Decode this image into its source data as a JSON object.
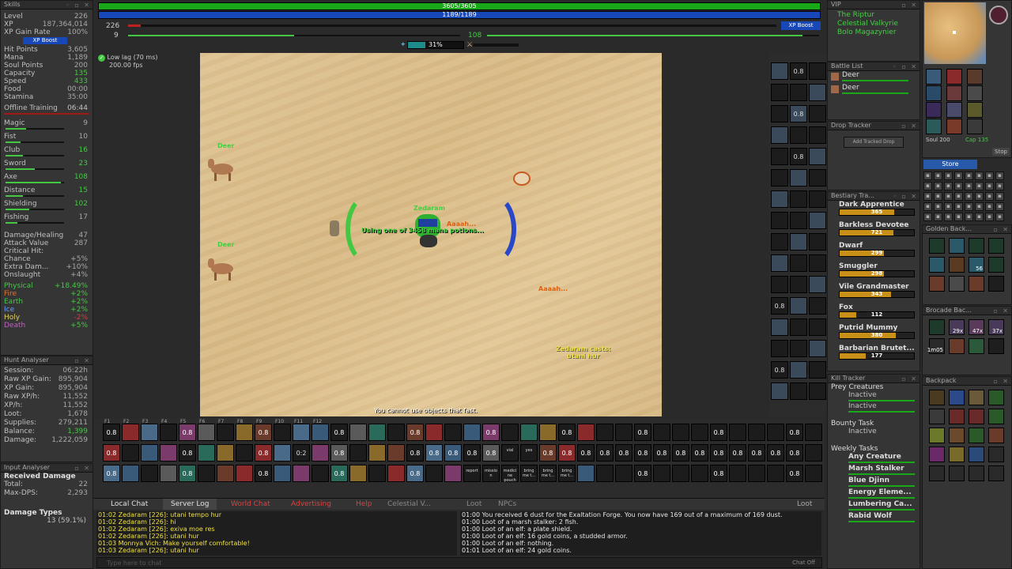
{
  "skills": {
    "title": "Skills",
    "stats": [
      {
        "label": "Level",
        "value": "226",
        "cls": "gray"
      },
      {
        "label": "XP",
        "value": "187,364,014",
        "cls": "gray"
      },
      {
        "label": "XP Gain Rate",
        "value": "100%",
        "cls": "gray"
      }
    ],
    "xp_boost": "XP Boost",
    "vitals": [
      {
        "label": "Hit Points",
        "value": "3,605",
        "cls": "gray"
      },
      {
        "label": "Mana",
        "value": "1,189",
        "cls": "gray"
      },
      {
        "label": "Soul Points",
        "value": "200",
        "cls": "gray"
      },
      {
        "label": "Capacity",
        "value": "135",
        "cls": "green"
      },
      {
        "label": "Speed",
        "value": "433",
        "cls": "green"
      },
      {
        "label": "Food",
        "value": "00:00",
        "cls": "gray"
      },
      {
        "label": "Stamina",
        "value": "35:00",
        "cls": "gray"
      }
    ],
    "offline_training": {
      "label": "Offline Training",
      "value": "06:44"
    },
    "skill_list": [
      {
        "label": "Magic",
        "value": "9",
        "cls": "gray",
        "progress": 0.35
      },
      {
        "label": "Fist",
        "value": "10",
        "cls": "gray",
        "progress": 0.25
      },
      {
        "label": "Club",
        "value": "16",
        "cls": "green",
        "progress": 0.3
      },
      {
        "label": "Sword",
        "value": "23",
        "cls": "green",
        "progress": 0.5
      },
      {
        "label": "Axe",
        "value": "108",
        "cls": "green",
        "progress": 0.95
      },
      {
        "label": "Distance",
        "value": "15",
        "cls": "green",
        "progress": 0.3
      },
      {
        "label": "Shielding",
        "value": "102",
        "cls": "green",
        "progress": 0.4
      },
      {
        "label": "Fishing",
        "value": "17",
        "cls": "gray",
        "progress": 0.2
      }
    ],
    "combat": [
      {
        "label": "Damage/Healing",
        "value": "47"
      },
      {
        "label": "Attack Value",
        "value": "287"
      },
      {
        "label": "Critical Hit:",
        "value": ""
      },
      {
        "label": "  Chance",
        "value": "+5%"
      },
      {
        "label": "  Extra Dam...",
        "value": "+10%"
      },
      {
        "label": "Onslaught",
        "value": "+4%"
      }
    ],
    "resists": [
      {
        "label": "Physical",
        "value": "+18.49%",
        "cls": "green"
      },
      {
        "label": "Fire",
        "value": "+2%",
        "cls": "green"
      },
      {
        "label": "Earth",
        "value": "+2%",
        "cls": "green"
      },
      {
        "label": "Ice",
        "value": "+2%",
        "cls": "green"
      },
      {
        "label": "Holy",
        "value": "-2%",
        "cls": "red"
      },
      {
        "label": "Death",
        "value": "+5%",
        "cls": "green"
      }
    ]
  },
  "hunt": {
    "title": "Hunt Analyser",
    "rows": [
      {
        "label": "Session:",
        "value": "06:22h",
        "cls": "gray"
      },
      {
        "label": "Raw XP Gain:",
        "value": "895,904",
        "cls": "gray"
      },
      {
        "label": "XP Gain:",
        "value": "895,904",
        "cls": "gray"
      },
      {
        "label": "Raw XP/h:",
        "value": "11,552",
        "cls": "gray"
      },
      {
        "label": "XP/h:",
        "value": "11,552",
        "cls": "gray"
      },
      {
        "label": "Loot:",
        "value": "1,678",
        "cls": "gray"
      },
      {
        "label": "Supplies:",
        "value": "279,211",
        "cls": "gray"
      },
      {
        "label": "Balance:",
        "value": "1,399",
        "cls": "green"
      },
      {
        "label": "Damage:",
        "value": "1,222,059",
        "cls": "gray"
      }
    ]
  },
  "input": {
    "title": "Input Analyser",
    "sub": "Received Damage",
    "rows": [
      {
        "label": "Total:",
        "value": "22"
      },
      {
        "label": "Max-DPS:",
        "value": "2,293"
      }
    ],
    "types_label": "Damage Types",
    "types_value": "13 (59.1%)"
  },
  "top": {
    "hp": "3605/3605",
    "mana": "1189/1189",
    "level": "226",
    "magic": "9",
    "skill_value": "108",
    "xp_boost": "XP Boost",
    "percent": "31%"
  },
  "status": {
    "lag": "Low lag (70 ms)",
    "fps": "200.00 fps"
  },
  "game": {
    "deer1": "Deer",
    "deer2": "Deer",
    "player": "Zedaram",
    "potion_msg": "Using one of 3458 mana potions...",
    "aaah1": "Aaaah...",
    "aaah2": "Aaaah...",
    "cast_msg1": "Zedaram casts:",
    "cast_msg2": "utani hur",
    "footer_msg": "You cannot use objects that fast."
  },
  "vip": {
    "title": "VIP",
    "names": [
      "The Riptur",
      "Celestial Valkyrie",
      "Bolo Magazynier"
    ]
  },
  "battle": {
    "title": "Battle List",
    "entries": [
      "Deer",
      "Deer"
    ]
  },
  "drop": {
    "title": "Drop Tracker",
    "button": "Add Tracked Drop"
  },
  "bestiary": {
    "title": "Bestiary Tra...",
    "entries": [
      {
        "name": "Dark Apprentice",
        "count": "365",
        "progress": 0.73
      },
      {
        "name": "Barkless Devotee",
        "count": "721",
        "progress": 0.72
      },
      {
        "name": "Dwarf",
        "count": "299",
        "progress": 0.6
      },
      {
        "name": "Smuggler",
        "count": "298",
        "progress": 0.6
      },
      {
        "name": "Vile Grandmaster",
        "count": "343",
        "progress": 0.69
      },
      {
        "name": "Fox",
        "count": "112",
        "progress": 0.22
      },
      {
        "name": "Putrid Mummy",
        "count": "380",
        "progress": 0.76
      },
      {
        "name": "Barbarian Brutet...",
        "count": "177",
        "progress": 0.35
      }
    ]
  },
  "kill": {
    "title": "Kill Tracker",
    "prey_label": "Prey Creatures",
    "prey": [
      "Inactive",
      "Inactive"
    ],
    "bounty_label": "Bounty Task",
    "bounty": "Inactive",
    "weekly_label": "Weekly Tasks",
    "weekly": [
      "Any Creature",
      "Marsh Stalker",
      "Blue Djinn",
      "Energy Eleme...",
      "Lumbering Ca...",
      "Rabid Wolf"
    ]
  },
  "right": {
    "store": "Store",
    "golden": "Golden Back...",
    "brocade": "Brocade Bac...",
    "backpack": "Backpack",
    "soul": "Soul",
    "soul_val": "200",
    "cap": "Cap",
    "cap_val": "135",
    "stop": "Stop",
    "brocade_counts": [
      "29x",
      "47x",
      "37x",
      "1m05"
    ],
    "golden_count": "56"
  },
  "actionbar": {
    "hotkeys": [
      "F1",
      "F2",
      "F3",
      "F4",
      "F5",
      "F6",
      "F7",
      "F8",
      "F9",
      "F10",
      "F11",
      "F12"
    ],
    "timer": "0.8",
    "timer2": "0:2",
    "labels": [
      "vial",
      "yes",
      "report",
      "missio n",
      "medici ne pouch",
      "bring me t...",
      "bring me t...",
      "bring me t..."
    ]
  },
  "chat": {
    "tabs": [
      "Local Chat",
      "Server Log",
      "World Chat",
      "Advertising",
      "Help",
      "Celestial V...",
      "Loot",
      "NPCs"
    ],
    "right_tab": "Loot",
    "left": [
      "01:02 Zedaram [226]: utani tempo hur",
      "01:02 Zedaram [226]: hi",
      "01:02 Zedaram [226]: exiva moe res",
      "01:02 Zedaram [226]: utani hur",
      "01:03 Monnya Vich: Make yourself comfortable!",
      "01:03 Zedaram [226]: utani hur"
    ],
    "right": [
      "01:00 You received 6 dust for the Exaltation Forge. You now have 169 out of a maximum of 169 dust.",
      "01:00 Loot of a marsh stalker: 2 fish.",
      "01:00 Loot of an elf: a plate shield.",
      "01:00 Loot of an elf: 16 gold coins, a studded armor.",
      "01:00 Loot of an elf: nothing.",
      "01:01 Loot of an elf: 24 gold coins."
    ],
    "placeholder": "Type here to chat",
    "chat_off": "Chat Off"
  },
  "colors": {
    "hp": "#18a818",
    "mana": "#1848b8",
    "sand": "#dcc08c",
    "accent": "#44c844"
  }
}
